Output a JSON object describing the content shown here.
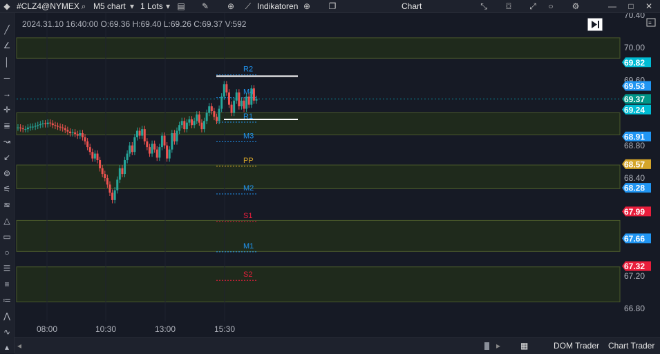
{
  "toolbar": {
    "symbol": "#CLZ4@NYMEX",
    "timeframe": "M5 chart",
    "lots": "1 Lots",
    "indicators": "Indikatoren",
    "title": "Chart",
    "icons": [
      "app-logo-icon",
      "search-icon",
      "chevron-down-icon",
      "chevron-down-icon",
      "order-icon",
      "pencil-icon",
      "zoom-icon",
      "indicator-icon",
      "crosshair-icon",
      "window-icon",
      "collapse-icon",
      "camera-icon",
      "expand-icon",
      "circle-icon",
      "gear-icon",
      "minimize-icon",
      "maximize-icon",
      "close-icon"
    ]
  },
  "ohlc_info": "2024.31.10 16:40:00 O:69.36 H:69.40 L:69.26 C:69.37 V:592",
  "bottom": {
    "dom_trader": "DOM Trader",
    "chart_trader": "Chart Trader"
  },
  "colors": {
    "bg": "#161a25",
    "up": "#26a69a",
    "down": "#ef5350",
    "zone": "#1f2a1c",
    "zone_border": "#4b5a2b",
    "cyan": "#00bcd4",
    "blue": "#2196f3",
    "teal": "#009688",
    "red": "#e91e3c",
    "gold": "#d4a52a"
  },
  "chart_data": {
    "type": "candlestick",
    "y_ticks": [
      "70.40",
      "70.00",
      "69.60",
      "68.80",
      "68.40",
      "67.20",
      "66.80"
    ],
    "x_ticks": [
      "08:00",
      "10:30",
      "13:00",
      "15:30"
    ],
    "ylim": [
      66.6,
      70.45
    ],
    "zones": [
      [
        69.87,
        70.12
      ],
      [
        69.2,
        68.93
      ],
      [
        68.56,
        68.27
      ],
      [
        67.88,
        67.5
      ],
      [
        67.31,
        66.88
      ]
    ],
    "pivots": [
      {
        "name": "R2",
        "value": 69.75,
        "color": "#2196f3"
      },
      {
        "name": "M4",
        "value": 69.47,
        "color": "#2196f3"
      },
      {
        "name": "R1",
        "value": 69.17,
        "color": "#2196f3"
      },
      {
        "name": "M3",
        "value": 68.93,
        "color": "#2196f3"
      },
      {
        "name": "PP",
        "value": 68.63,
        "color": "#d4a52a"
      },
      {
        "name": "M2",
        "value": 68.29,
        "color": "#2196f3"
      },
      {
        "name": "S1",
        "value": 67.95,
        "color": "#e91e3c"
      },
      {
        "name": "M1",
        "value": 67.58,
        "color": "#2196f3"
      },
      {
        "name": "S2",
        "value": 67.23,
        "color": "#e91e3c"
      }
    ],
    "price_labels": [
      {
        "text": "69.82",
        "value": 69.82,
        "color": "#00bcd4"
      },
      {
        "text": "69.53",
        "value": 69.53,
        "color": "#2196f3"
      },
      {
        "text": "69.37",
        "value": 69.37,
        "color": "#009688"
      },
      {
        "text": "69.24",
        "value": 69.24,
        "color": "#00bcd4"
      },
      {
        "text": "68.91",
        "value": 68.91,
        "color": "#2196f3"
      },
      {
        "text": "68.57",
        "value": 68.57,
        "color": "#d4a52a"
      },
      {
        "text": "68.28",
        "value": 68.28,
        "color": "#2196f3"
      },
      {
        "text": "67.99",
        "value": 67.99,
        "color": "#e91e3c"
      },
      {
        "text": "67.66",
        "value": 67.66,
        "color": "#2196f3"
      },
      {
        "text": "67.32",
        "value": 67.32,
        "color": "#e91e3c"
      }
    ],
    "current_price": 69.37,
    "box": {
      "top": 69.65,
      "bottom": 69.12
    },
    "closes": [
      69.02,
      69.01,
      69.0,
      69.0,
      69.02,
      69.03,
      69.03,
      69.04,
      69.05,
      69.06,
      69.07,
      69.06,
      69.08,
      69.07,
      69.05,
      69.04,
      69.03,
      69.02,
      69.01,
      68.99,
      68.97,
      68.95,
      68.96,
      68.94,
      68.92,
      68.95,
      68.9,
      68.85,
      68.78,
      68.72,
      68.64,
      68.7,
      68.62,
      68.52,
      68.45,
      68.4,
      68.32,
      68.22,
      68.13,
      68.25,
      68.38,
      68.52,
      68.45,
      68.62,
      68.7,
      68.8,
      68.72,
      68.9,
      68.98,
      68.92,
      69.0,
      68.85,
      68.78,
      68.7,
      68.82,
      68.75,
      68.65,
      68.78,
      68.92,
      68.8,
      68.64,
      68.75,
      68.95,
      68.85,
      68.98,
      69.05,
      69.1,
      69.0,
      69.08,
      69.12,
      69.05,
      69.1,
      69.18,
      69.08,
      69.0,
      69.1,
      69.2,
      69.28,
      69.22,
      69.15,
      69.1,
      69.25,
      69.4,
      69.55,
      69.45,
      69.3,
      69.2,
      69.35,
      69.45,
      69.28,
      69.35,
      69.25,
      69.4,
      69.3,
      69.5,
      69.35,
      69.37
    ]
  }
}
